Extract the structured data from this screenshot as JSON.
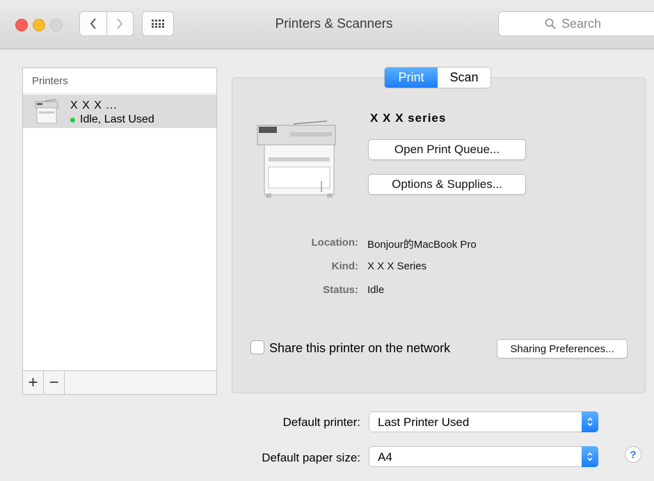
{
  "window": {
    "title": "Printers & Scanners"
  },
  "search": {
    "placeholder": "Search"
  },
  "printers_list": {
    "header": "Printers",
    "items": [
      {
        "name": "X X X ...",
        "status": "Idle, Last Used",
        "status_color": "#27c93f"
      }
    ],
    "toolbar": {
      "add_label": "+",
      "remove_label": "−"
    }
  },
  "tabs": {
    "items": [
      "Print",
      "Scan"
    ],
    "active": "Print",
    "active_color": "#1b7ef7"
  },
  "details": {
    "device_name": "X X X  series",
    "open_queue_label": "Open Print Queue...",
    "options_supplies_label": "Options & Supplies...",
    "info": [
      {
        "label": "Location:",
        "value": "Bonjour的MacBook Pro"
      },
      {
        "label": "Kind:",
        "value": "X X X  Series"
      },
      {
        "label": "Status:",
        "value": "Idle"
      }
    ],
    "share_label": "Share this printer on the network",
    "share_checked": false,
    "sharing_prefs_label": "Sharing Preferences..."
  },
  "defaults": {
    "printer_label": "Default printer:",
    "printer_value": "Last Printer Used",
    "paper_label": "Default paper size:",
    "paper_value": "A4"
  },
  "help_label": "?"
}
